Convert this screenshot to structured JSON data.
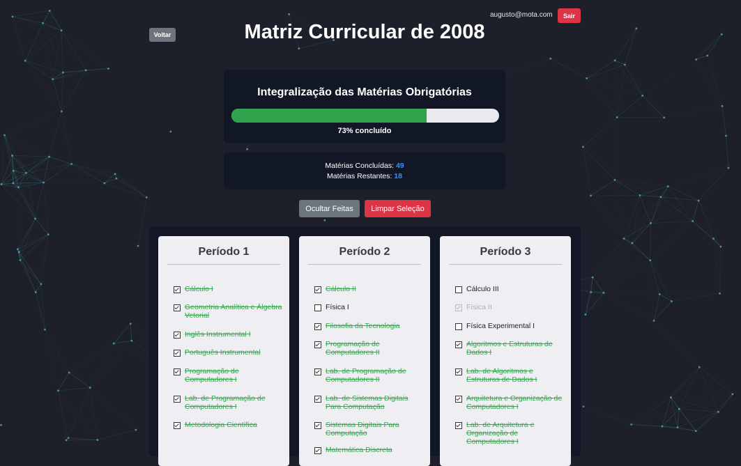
{
  "header": {
    "email": "augusto@mota.com",
    "logout_label": "Sair",
    "back_label": "Voltar",
    "title": "Matriz Curricular de 2008"
  },
  "progress": {
    "title": "Integralização das Matérias Obrigatórias",
    "percent": 73,
    "label": "73% concluído"
  },
  "stats": {
    "completed_label": "Matérias Concluídas:",
    "completed_value": "49",
    "remaining_label": "Matérias Restantes:",
    "remaining_value": "18"
  },
  "actions": {
    "hide_done_label": "Ocultar Feitas",
    "clear_label": "Limpar Seleção"
  },
  "colors": {
    "accent_green": "#31a24c",
    "danger": "#dc3545",
    "number_blue": "#3d8bfd"
  },
  "periods": [
    {
      "title": "Período 1",
      "courses": [
        {
          "name": "Cálculo I",
          "state": "done"
        },
        {
          "name": "Geometria Analítica e Álgebra Vetorial",
          "state": "done"
        },
        {
          "name": "Inglês Instrumental I",
          "state": "done"
        },
        {
          "name": "Português Instrumental",
          "state": "done"
        },
        {
          "name": "Programação de Computadores I",
          "state": "done"
        },
        {
          "name": "Lab. de Programação de Computadores I",
          "state": "done"
        },
        {
          "name": "Metodologia Científica",
          "state": "done"
        }
      ]
    },
    {
      "title": "Período 2",
      "courses": [
        {
          "name": "Cálculo II",
          "state": "done"
        },
        {
          "name": "Física I",
          "state": "todo"
        },
        {
          "name": "Filosofia da Tecnologia",
          "state": "done"
        },
        {
          "name": "Programação de Computadores II",
          "state": "done"
        },
        {
          "name": "Lab. de Programação de Computadores II",
          "state": "done"
        },
        {
          "name": "Lab. de Sistemas Digitais Para Computação",
          "state": "done"
        },
        {
          "name": "Sistemas Digitais Para Computação",
          "state": "done"
        },
        {
          "name": "Matemática Discreta",
          "state": "done"
        }
      ]
    },
    {
      "title": "Período 3",
      "courses": [
        {
          "name": "Cálculo III",
          "state": "todo"
        },
        {
          "name": "Física II",
          "state": "disabled"
        },
        {
          "name": "Física Experimental I",
          "state": "todo"
        },
        {
          "name": "Algoritmos e Estruturas de Dados I",
          "state": "done"
        },
        {
          "name": "Lab. de Algoritmos e Estruturas de Dados I",
          "state": "done"
        },
        {
          "name": "Arquitetura e Organização de Computadores I",
          "state": "done"
        },
        {
          "name": "Lab. de Arquitetura e Organização de Computadores I",
          "state": "done"
        }
      ]
    }
  ]
}
